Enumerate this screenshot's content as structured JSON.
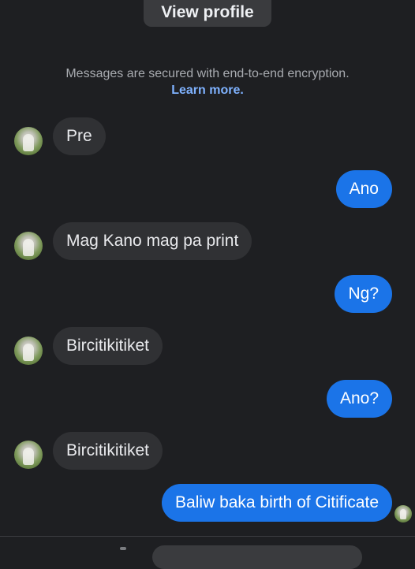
{
  "header": {
    "view_profile_label": "View profile"
  },
  "notice": {
    "text": "Messages are secured with end-to-end encryption.",
    "learn_more": "Learn more."
  },
  "messages": [
    {
      "direction": "incoming",
      "text": "Pre"
    },
    {
      "direction": "outgoing",
      "text": "Ano"
    },
    {
      "direction": "incoming",
      "text": "Mag Kano mag pa print"
    },
    {
      "direction": "outgoing",
      "text": "Ng?"
    },
    {
      "direction": "incoming",
      "text": "Bircitikitiket"
    },
    {
      "direction": "outgoing",
      "text": "Ano?"
    },
    {
      "direction": "incoming",
      "text": "Bircitikitiket"
    },
    {
      "direction": "outgoing",
      "text": "Baliw baka birth of Citificate"
    }
  ],
  "colors": {
    "background": "#1e1f22",
    "incoming_bubble": "#303134",
    "outgoing_bubble": "#1b74e8",
    "link": "#7fb2ff",
    "muted_text": "#a8abb0"
  },
  "icons": {
    "contact_avatar": "avatar",
    "read_receipt": "seen-avatar-icon"
  }
}
